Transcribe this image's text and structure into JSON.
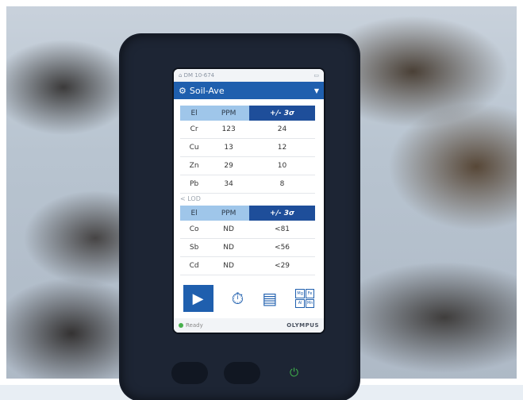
{
  "screen": {
    "status": {
      "left": "DM 10-674"
    },
    "title": "Soil-Ave",
    "results": {
      "headers": [
        "El",
        "PPM",
        "+/- 3σ"
      ],
      "rows": [
        {
          "el": "Cr",
          "ppm": "123",
          "err": "24"
        },
        {
          "el": "Cu",
          "ppm": "13",
          "err": "12"
        },
        {
          "el": "Zn",
          "ppm": "29",
          "err": "10"
        },
        {
          "el": "Pb",
          "ppm": "34",
          "err": "8"
        }
      ]
    },
    "lod_label": "< LOD",
    "lod": {
      "headers": [
        "El",
        "PPM",
        "+/- 3σ"
      ],
      "rows": [
        {
          "el": "Co",
          "ppm": "ND",
          "err": "<81"
        },
        {
          "el": "Sb",
          "ppm": "ND",
          "err": "<56"
        },
        {
          "el": "Cd",
          "ppm": "ND",
          "err": "<29"
        }
      ]
    },
    "toolbar": {
      "periodic": [
        "Mg",
        "Fe",
        "Al",
        "Mn"
      ]
    },
    "footer": {
      "status": "Ready",
      "brand": "OLYMPUS"
    }
  }
}
